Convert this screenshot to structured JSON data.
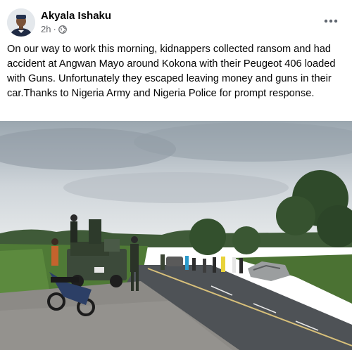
{
  "post": {
    "author_name": "Akyala Ishaku",
    "timestamp": "2h",
    "separator": "·",
    "audience_icon": "globe-icon",
    "more_icon": "more-options-icon",
    "body": "On our way to work this morning, kidnappers collected ransom and had accident at Angwan Mayo around Kokona with their Peugeot 406 loaded with Guns. Unfortunately they escaped leaving money and guns in their car.Thanks to Nigeria Army and Nigeria Police for prompt response."
  },
  "colors": {
    "text_primary": "#050505",
    "text_secondary": "#65676b",
    "sky": "#c9d0d6",
    "road": "#4e5256",
    "grass": "#4f7a36"
  }
}
